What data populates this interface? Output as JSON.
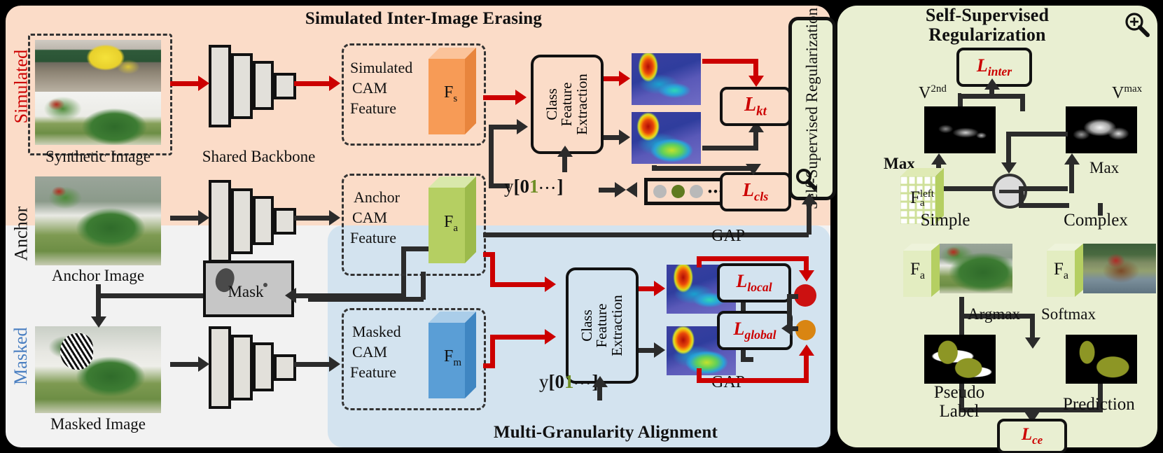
{
  "figure": {
    "panels": {
      "simulated_inter_image_erasing": {
        "title": "Simulated Inter-Image Erasing",
        "bg_color": "#fbdcc8"
      },
      "multi_granularity_alignment": {
        "title": "Multi-Granularity  Alignment",
        "bg_color": "#d3e3ef"
      },
      "self_supervised_regularization": {
        "title_line1": "Self-Supervised",
        "title_line2": "Regularization",
        "bg_color": "#e9efd2",
        "vertical_label": "Self-Supervised Regularization"
      },
      "anchor_row": {
        "bg_color": "#f2f2f2"
      }
    },
    "row_labels": {
      "simulated": {
        "text": "Simulated",
        "color": "#cc0000"
      },
      "anchor": {
        "text": "Anchor",
        "color": "#111111"
      },
      "masked": {
        "text": "Masked",
        "color": "#4a7fc1"
      }
    },
    "input_images": {
      "synthetic": "Synthetic Image",
      "anchor": "Anchor Image",
      "masked": "Masked Image"
    },
    "backbone_label": "Shared Backbone",
    "mask_label": "Mask",
    "cam_features": {
      "simulated": {
        "line1": "Simulated",
        "line2": "CAM",
        "line3": "Feature",
        "symbol": "F",
        "sub": "s",
        "color": "#f79b56"
      },
      "anchor": {
        "line1": "Anchor",
        "line2": "CAM",
        "line3": "Feature",
        "symbol": "F",
        "sub": "a",
        "color": "#b5cf62"
      },
      "masked": {
        "line1": "Masked",
        "line2": "CAM",
        "line3": "Feature",
        "symbol": "F",
        "sub": "m",
        "color": "#5a9ed6"
      }
    },
    "class_feature_extraction": {
      "line1": "Class",
      "line2": "Feature",
      "line3": "Extraction"
    },
    "label_vector": {
      "prefix": "y",
      "open": "[",
      "values": [
        "0",
        "1"
      ],
      "ellipsis": "···",
      "close": "]",
      "highlight_color": "#6f8f26"
    },
    "logit_dots": [
      "gray",
      "olive",
      "gray",
      "ellipsis",
      "darkgray"
    ],
    "losses": {
      "kt": {
        "base": "L",
        "sub": "kt"
      },
      "cls": {
        "base": "L",
        "sub": "cls"
      },
      "local": {
        "base": "L",
        "sub": "local"
      },
      "global": {
        "base": "L",
        "sub": "global"
      },
      "inter": {
        "base": "L",
        "sub": "inter"
      },
      "ce": {
        "base": "L",
        "sub": "ce"
      }
    },
    "gap_labels": {
      "top": "GAP",
      "bottom": "GAP"
    },
    "markers": {
      "local_color": "#cc1111",
      "global_color": "#d98512"
    },
    "ssr": {
      "v_second": {
        "base": "V",
        "sup": "2nd"
      },
      "v_max": {
        "base": "V",
        "sup": "max"
      },
      "max_left": "Max",
      "max_right": "Max",
      "feature_left": {
        "base": "F",
        "sup": "left",
        "sub": "a"
      },
      "simple": "Simple",
      "complex": "Complex",
      "fa_simple": {
        "base": "F",
        "sub": "a"
      },
      "fa_complex": {
        "base": "F",
        "sub": "a"
      },
      "argmax": "Argmax",
      "softmax": "Softmax",
      "pseudo_label_line1": "Pseudo",
      "pseudo_label_line2": "Label",
      "prediction": "Prediction",
      "minus_operator": "−",
      "magnifier_icon": "magnifier-plus-icon"
    },
    "colors": {
      "red_arrow": "#cc0000",
      "black_arrow": "#2b2b2b",
      "loss_text": "#cc0000"
    }
  }
}
